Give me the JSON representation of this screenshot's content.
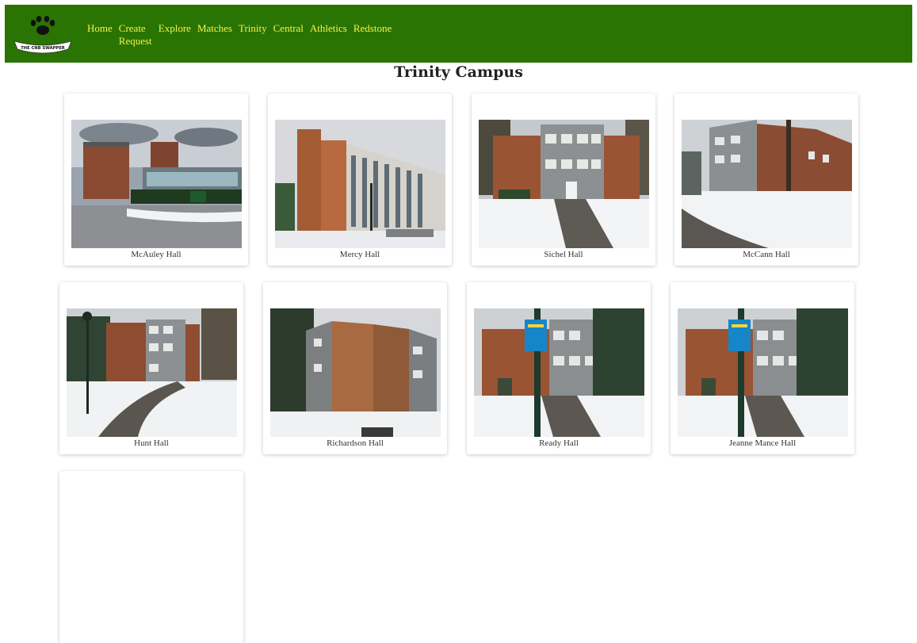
{
  "nav": {
    "logo_text": "THE CNB SWAPPER",
    "links": [
      "Home",
      "Create Request",
      "Explore",
      "Matches",
      "Trinity",
      "Central",
      "Athletics",
      "Redstone"
    ]
  },
  "page": {
    "title": "Trinity Campus"
  },
  "halls": [
    {
      "name": "McAuley Hall"
    },
    {
      "name": "Mercy Hall"
    },
    {
      "name": "Sichel Hall"
    },
    {
      "name": "McCann Hall"
    },
    {
      "name": "Hunt Hall"
    },
    {
      "name": "Richardson Hall"
    },
    {
      "name": "Ready Hall"
    },
    {
      "name": "Jeanne Mance Hall"
    },
    {
      "name": ""
    }
  ],
  "colors": {
    "nav_bg": "#2a7403",
    "nav_link": "#f5f24a"
  }
}
